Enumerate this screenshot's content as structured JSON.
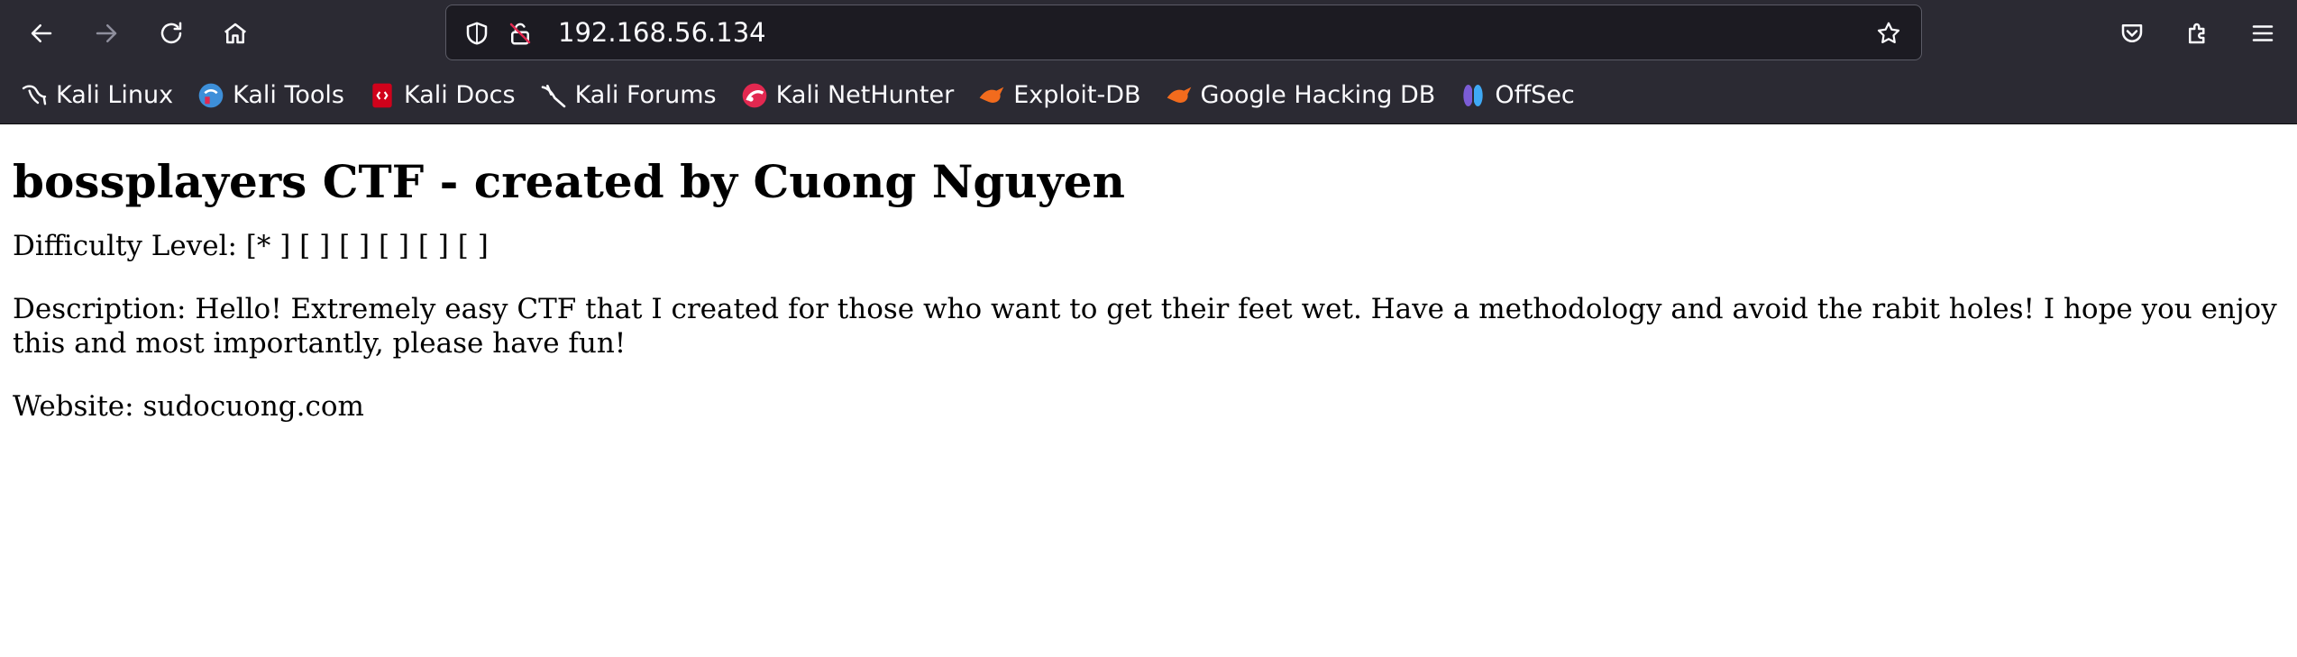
{
  "browser": {
    "url": "192.168.56.134"
  },
  "bookmarks": [
    {
      "label": "Kali Linux",
      "icon": "kali-dragon-icon"
    },
    {
      "label": "Kali Tools",
      "icon": "kali-tools-icon"
    },
    {
      "label": "Kali Docs",
      "icon": "kali-docs-icon"
    },
    {
      "label": "Kali Forums",
      "icon": "kali-forums-icon"
    },
    {
      "label": "Kali NetHunter",
      "icon": "kali-nethunter-icon"
    },
    {
      "label": "Exploit-DB",
      "icon": "exploit-db-icon"
    },
    {
      "label": "Google Hacking DB",
      "icon": "ghdb-icon"
    },
    {
      "label": "OffSec",
      "icon": "offsec-icon"
    }
  ],
  "page": {
    "title": "bossplayers CTF - created by Cuong Nguyen",
    "difficulty": "Difficulty Level: [* ] [ ] [ ] [ ] [ ] [ ]",
    "description": "Description: Hello! Extremely easy CTF that I created for those who want to get their feet wet. Have a methodology and avoid the rabit holes! I hope you enjoy this and most importantly, please have fun!",
    "website": "Website: sudocuong.com"
  },
  "colors": {
    "chrome_bg": "#2b2a33",
    "urlbar_bg": "#1c1b22",
    "chrome_text": "#fbfbfe",
    "page_bg": "#ffffff"
  }
}
